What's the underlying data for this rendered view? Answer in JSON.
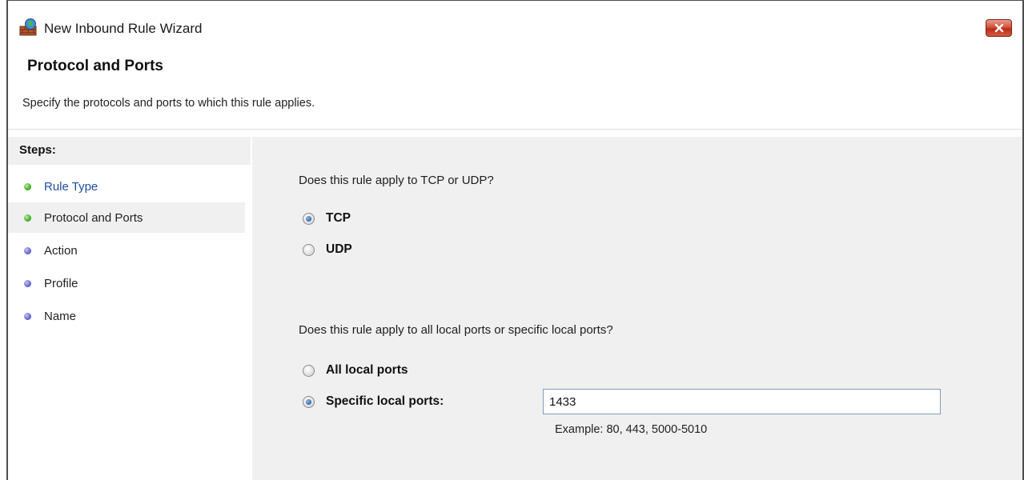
{
  "window": {
    "title": "New Inbound Rule Wizard",
    "close_icon": "close-icon"
  },
  "header": {
    "title": "Protocol and Ports",
    "subtitle": "Specify the protocols and ports to which this rule applies."
  },
  "steps": {
    "heading": "Steps:",
    "items": [
      {
        "label": "Rule Type",
        "state": "done",
        "style": "link"
      },
      {
        "label": "Protocol and Ports",
        "state": "done",
        "style": "current"
      },
      {
        "label": "Action",
        "state": "todo",
        "style": "plain"
      },
      {
        "label": "Profile",
        "state": "todo",
        "style": "plain"
      },
      {
        "label": "Name",
        "state": "todo",
        "style": "plain"
      }
    ]
  },
  "protocol": {
    "question": "Does this rule apply to TCP or UDP?",
    "options": [
      {
        "label": "TCP",
        "checked": true
      },
      {
        "label": "UDP",
        "checked": false
      }
    ]
  },
  "ports": {
    "question": "Does this rule apply to all local ports or specific local ports?",
    "options": [
      {
        "label": "All local ports",
        "checked": false
      },
      {
        "label": "Specific local ports:",
        "checked": true
      }
    ],
    "value": "1433",
    "example": "Example: 80, 443, 5000-5010"
  },
  "colors": {
    "step_done": "#33a11b",
    "step_todo": "#5b55c7",
    "link": "#1f4e9c",
    "close_button": "#c8452d"
  }
}
